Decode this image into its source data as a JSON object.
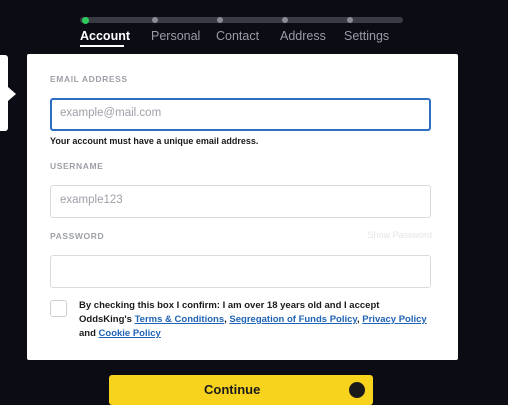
{
  "stepper": {
    "steps": [
      "Account",
      "Personal",
      "Contact",
      "Address",
      "Settings"
    ],
    "active_index": 0
  },
  "form": {
    "email": {
      "label": "EMAIL ADDRESS",
      "placeholder": "example@mail.com",
      "value": "",
      "hint": "Your account must have a unique email address."
    },
    "username": {
      "label": "USERNAME",
      "placeholder": "example123",
      "value": ""
    },
    "password": {
      "label": "PASSWORD",
      "placeholder": "",
      "value": "",
      "show_label": "Show Password"
    },
    "consent": {
      "checked": false,
      "text_before": "By checking this box I confirm: I am over 18 years old and I accept OddsKing's ",
      "link_terms": "Terms & Conditions",
      "sep1": ", ",
      "link_segregation": "Segregation of Funds Policy",
      "sep2": ", ",
      "link_privacy": "Privacy Policy",
      "sep3": " and ",
      "link_cookie": "Cookie Policy"
    }
  },
  "continue_button": {
    "label": "Continue"
  },
  "colors": {
    "background": "#0b0c14",
    "accent_active": "#2ecc5a",
    "focus_border": "#2c6fc1",
    "link": "#1f63b6",
    "button": "#f7d31e"
  },
  "icons": {
    "side_tab": "chevron-right-icon",
    "continue": "arrow-circle-icon"
  }
}
